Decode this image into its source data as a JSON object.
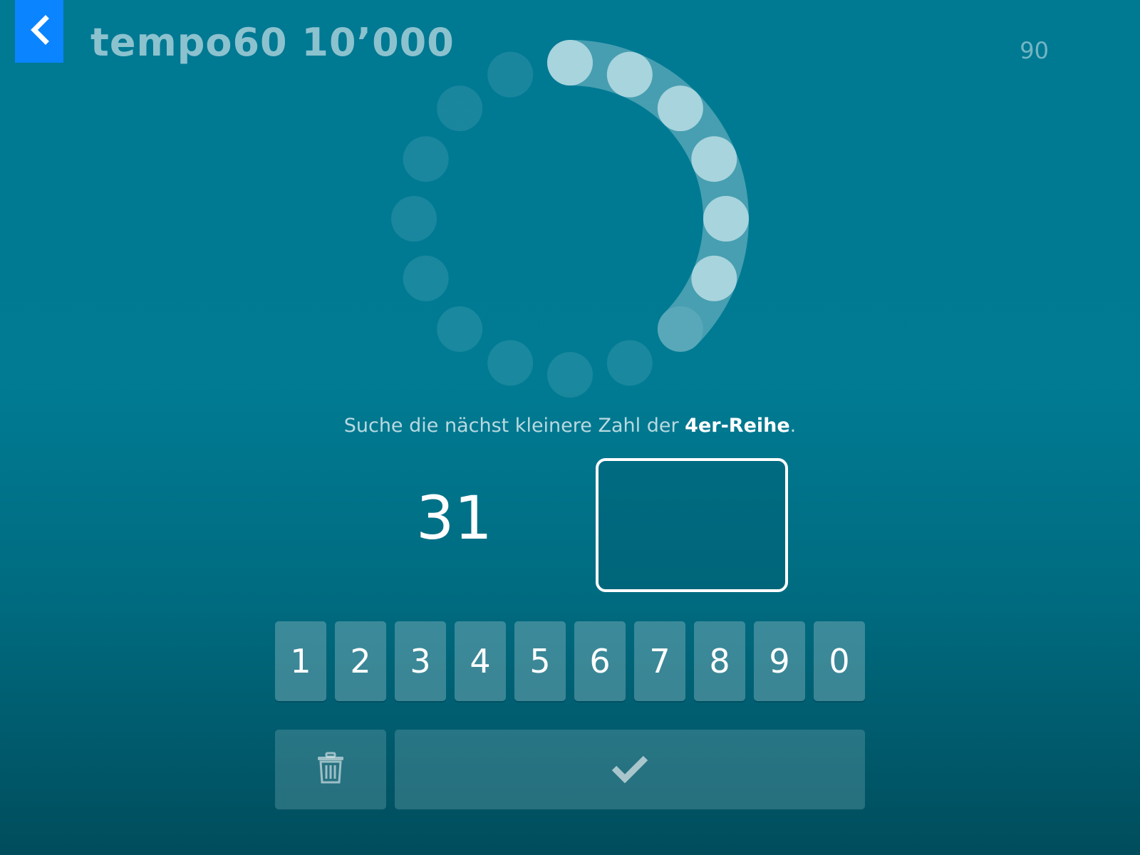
{
  "header": {
    "back_icon": "chevron-left-icon",
    "title": "tempo60 10’000",
    "score": "90"
  },
  "timer": {
    "total_dots": 16,
    "elapsed_dots": 6,
    "progress_fraction": 0.375
  },
  "task": {
    "prompt_prefix": "Suche die nächst kleinere Zahl der ",
    "prompt_highlight": "4er-Reihe",
    "prompt_suffix": ".",
    "number": "31",
    "answer_value": ""
  },
  "keypad": {
    "keys": [
      "1",
      "2",
      "3",
      "4",
      "5",
      "6",
      "7",
      "8",
      "9",
      "0"
    ],
    "delete_icon": "trash-icon",
    "submit_icon": "checkmark-icon"
  },
  "colors": {
    "accent_blue": "#0a84ff",
    "background_top": "#007993",
    "background_bottom": "#004d5c"
  }
}
